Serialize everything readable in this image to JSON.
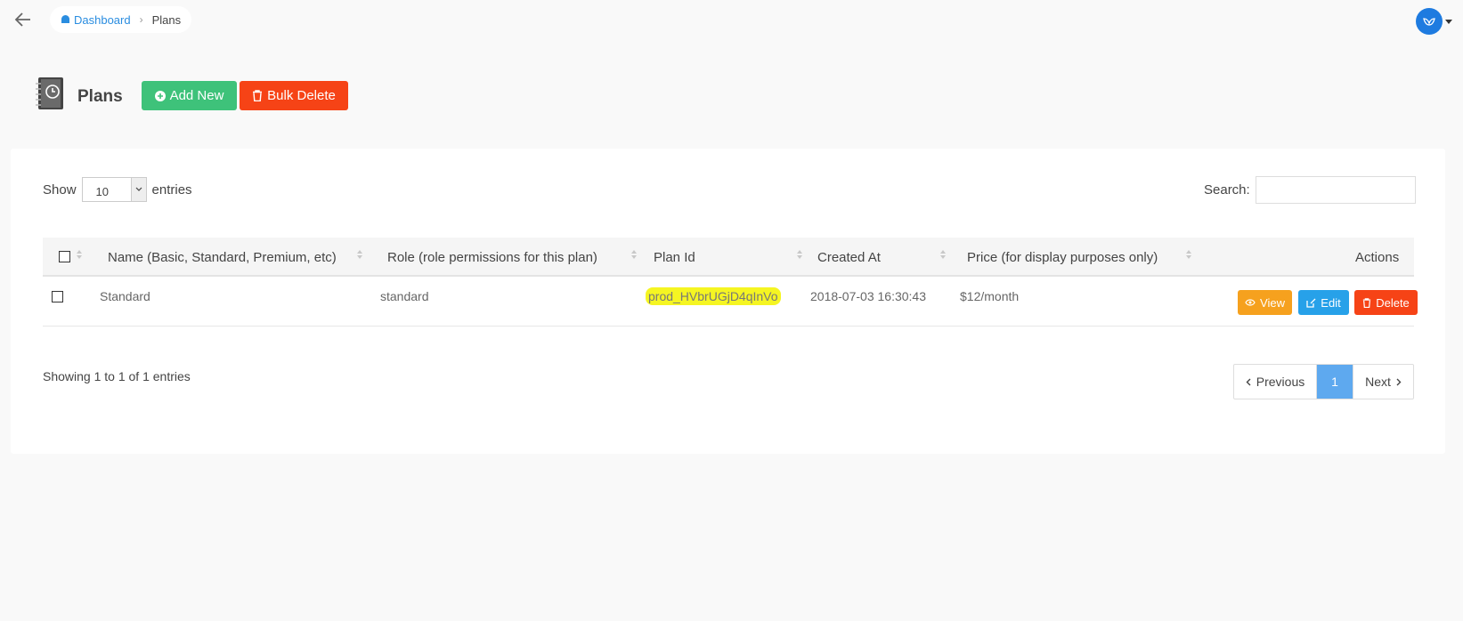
{
  "breadcrumb": {
    "home": "Dashboard",
    "current": "Plans"
  },
  "header": {
    "title": "Plans",
    "add_label": "Add New",
    "bulk_delete_label": "Bulk Delete"
  },
  "length": {
    "show_label": "Show",
    "value": "10",
    "entries_label": "entries"
  },
  "search": {
    "label": "Search:",
    "value": ""
  },
  "table": {
    "columns": [
      "Name (Basic, Standard, Premium, etc)",
      "Role (role permissions for this plan)",
      "Plan Id",
      "Created At",
      "Price (for display purposes only)",
      "Actions"
    ],
    "rows": [
      {
        "name": "Standard",
        "role": "standard",
        "plan_id": "prod_HVbrUGjD4qInVo",
        "created_at": "2018-07-03 16:30:43",
        "price": "$12/month",
        "actions": {
          "view": "View",
          "edit": "Edit",
          "delete": "Delete"
        }
      }
    ]
  },
  "footer": {
    "info": "Showing 1 to 1 of 1 entries",
    "prev_label": "Previous",
    "page": "1",
    "next_label": "Next"
  },
  "colors": {
    "add": "#3ec27a",
    "danger": "#f64316",
    "view": "#f6a11e",
    "edit": "#27a1e9",
    "active_page": "#5ea9ef",
    "highlight": "#f5f522"
  }
}
